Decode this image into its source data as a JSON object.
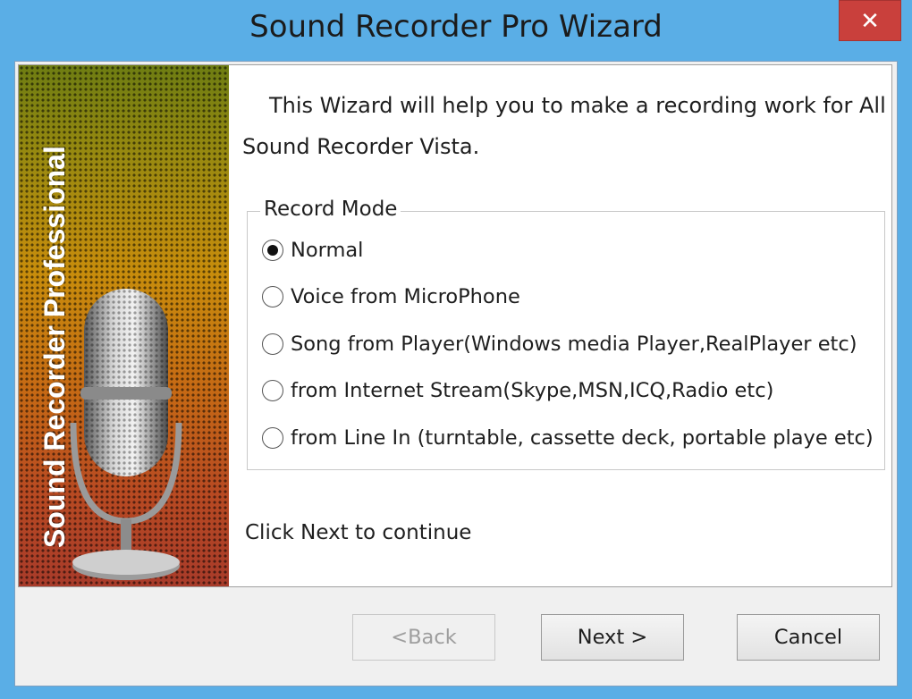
{
  "window": {
    "title": "Sound Recorder Pro Wizard",
    "close_label": "✕"
  },
  "banner": {
    "text": "Sound Recorder Professional",
    "icon": "microphone-icon"
  },
  "intro": "This Wizard will help you to make a recording work for All Sound Recorder Vista.",
  "record_mode": {
    "label": "Record Mode",
    "selected": 0,
    "options": [
      "Normal",
      "Voice from MicroPhone",
      "Song from Player(Windows media Player,RealPlayer etc)",
      "from Internet Stream(Skype,MSN,ICQ,Radio etc)",
      "from Line In (turntable, cassette deck, portable playe etc)"
    ]
  },
  "hint": "Click Next to continue",
  "buttons": {
    "back": "<Back",
    "next": "Next >",
    "cancel": "Cancel"
  },
  "colors": {
    "title_bar": "#5aaee6",
    "close_button": "#c9403c"
  }
}
